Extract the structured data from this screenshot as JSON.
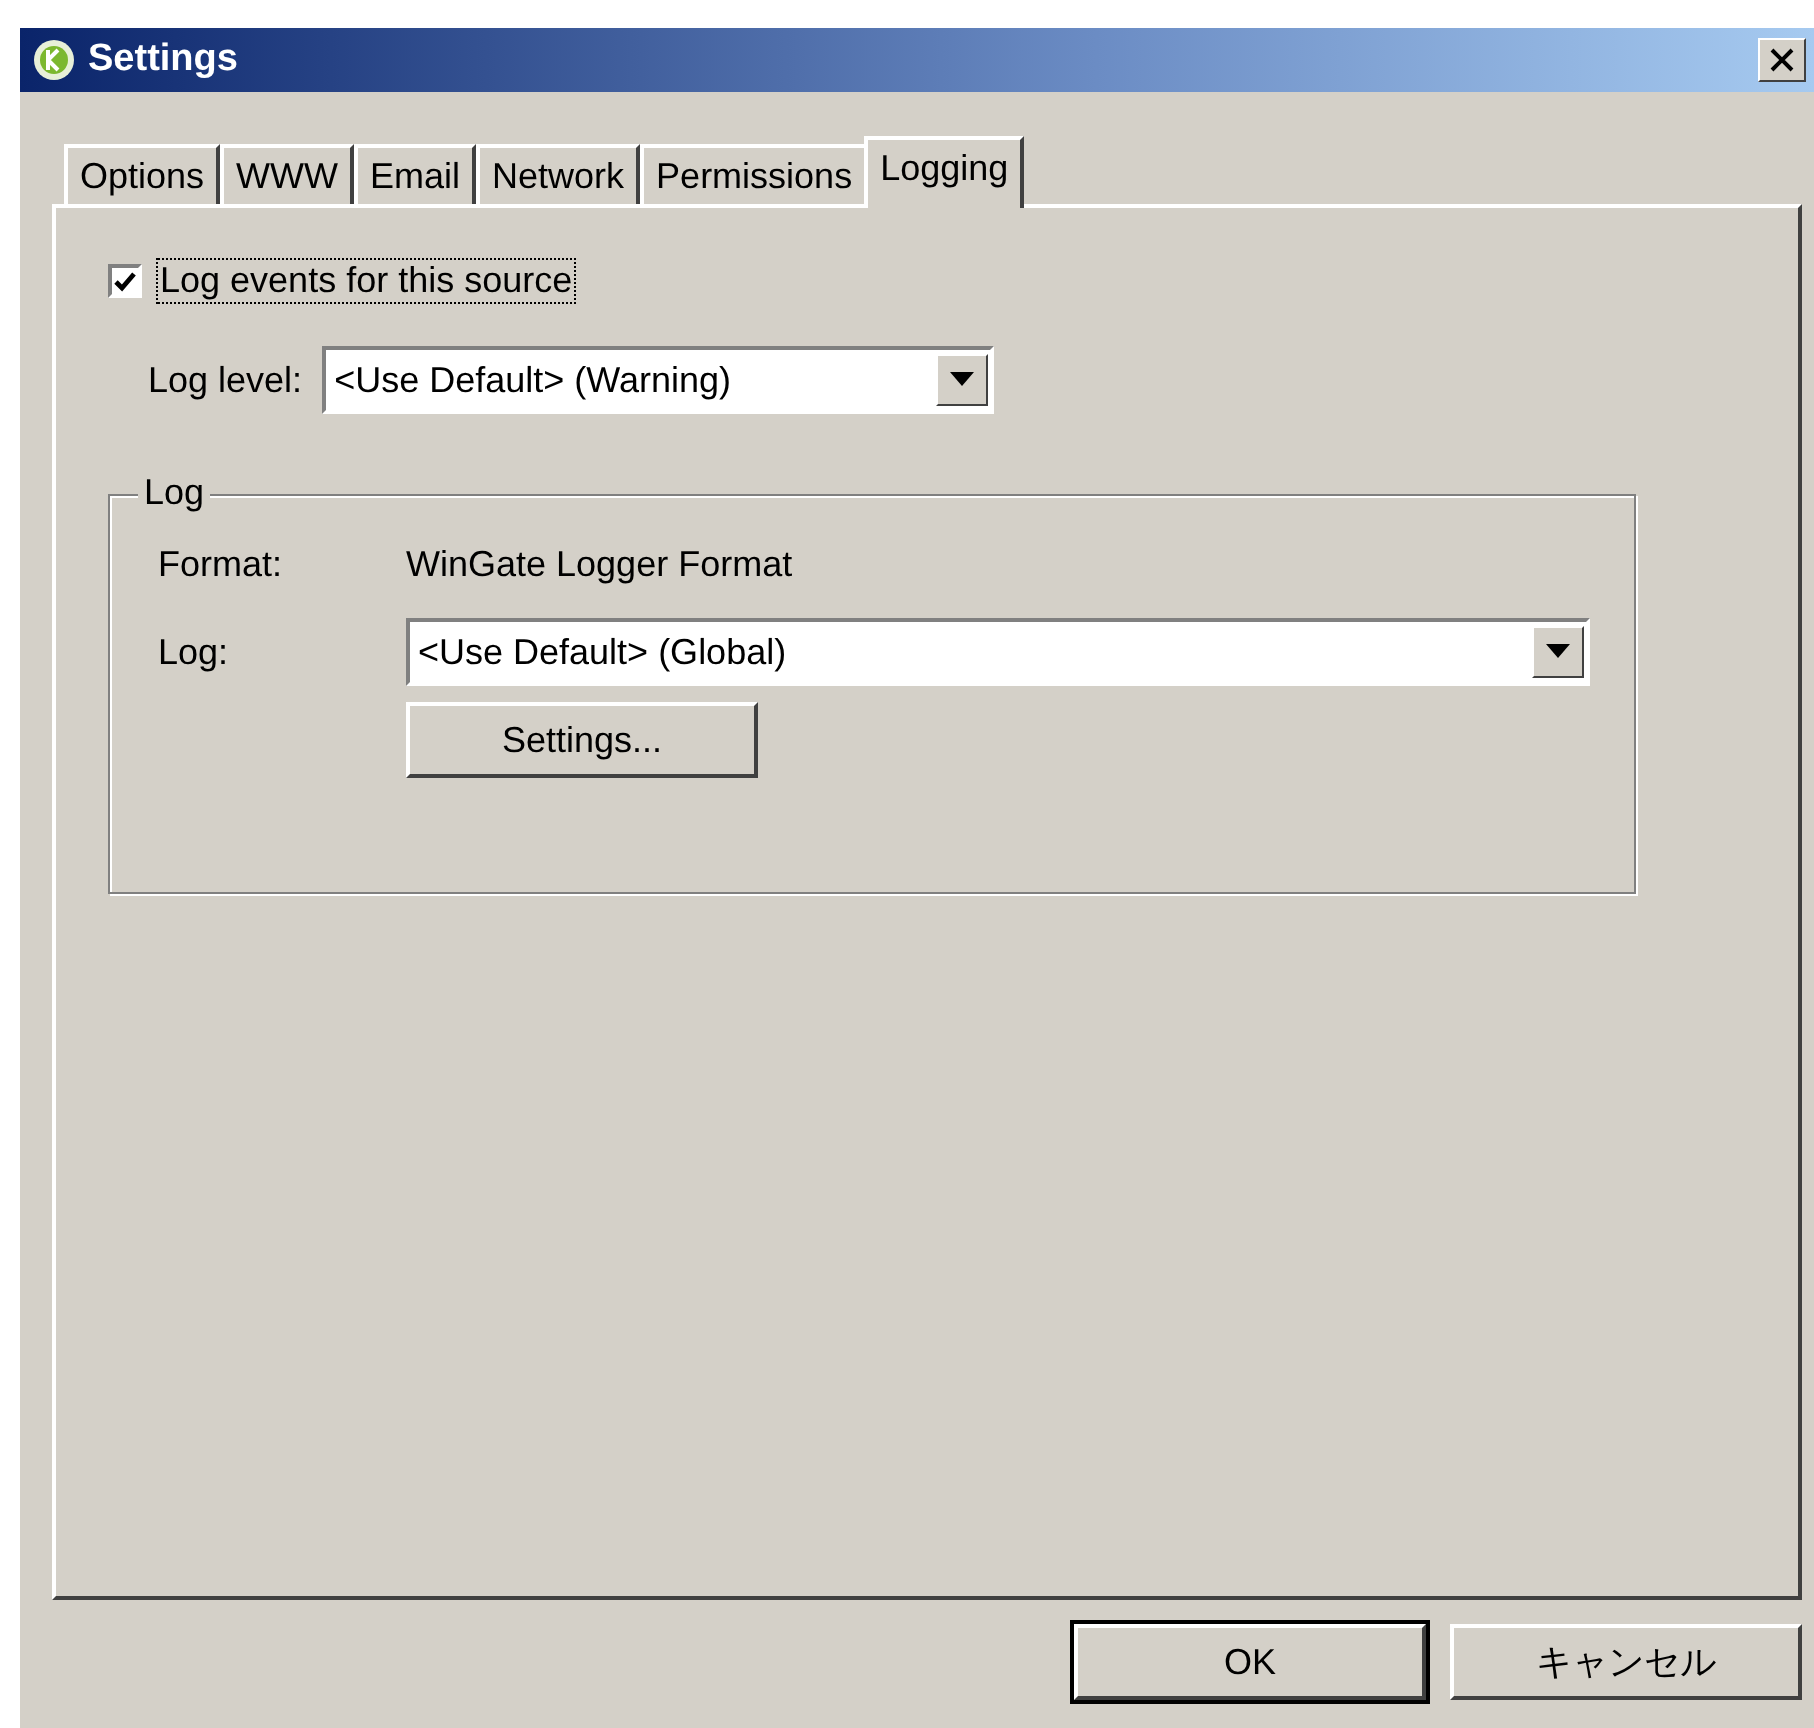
{
  "window": {
    "title": "Settings"
  },
  "tabs": [
    {
      "label": "Options",
      "selected": false
    },
    {
      "label": "WWW",
      "selected": false
    },
    {
      "label": "Email",
      "selected": false
    },
    {
      "label": "Network",
      "selected": false
    },
    {
      "label": "Permissions",
      "selected": false
    },
    {
      "label": "Logging",
      "selected": true
    }
  ],
  "log_events": {
    "label": "Log events for this source",
    "checked": true
  },
  "log_level": {
    "label": "Log level:",
    "value": "<Use Default> (Warning)"
  },
  "log_group": {
    "title": "Log",
    "format_label": "Format:",
    "format_value": "WinGate Logger Format",
    "log_label": "Log:",
    "log_value": "<Use Default> (Global)",
    "settings_button": "Settings..."
  },
  "buttons": [
    {
      "label": "OK",
      "default": true
    },
    {
      "label": "キャンセル",
      "default": false
    }
  ]
}
